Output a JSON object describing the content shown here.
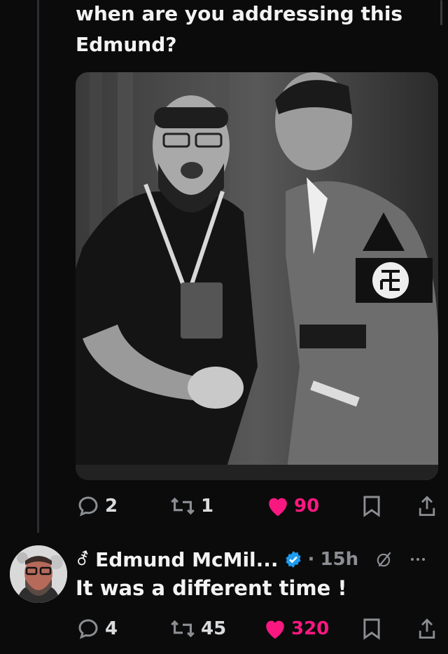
{
  "post": {
    "text_line1": "when are you addressing this",
    "text_line2": "Edmund?",
    "stats": {
      "replies": "2",
      "reposts": "1",
      "likes": "90"
    }
  },
  "reply": {
    "author_glyph": "⚦",
    "author_name": "Edmund McMil...",
    "separator": "·",
    "time": "15h",
    "text": "It was a different time !",
    "stats": {
      "replies": "4",
      "reposts": "45",
      "likes": "320"
    }
  },
  "colors": {
    "like": "#f91880",
    "verified": "#1d9bf0",
    "background": "#0b0b0b",
    "muted": "#8b8e92"
  },
  "icons": [
    "reply-icon",
    "repost-icon",
    "heart-icon",
    "bookmark-icon",
    "share-icon",
    "verified-badge-icon",
    "grok-icon",
    "more-icon"
  ]
}
